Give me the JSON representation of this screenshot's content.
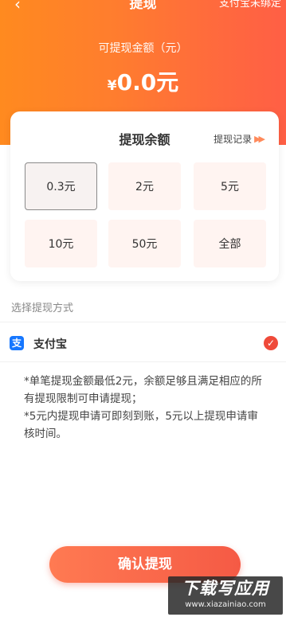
{
  "nav": {
    "back_icon": "chevron-left-icon",
    "title": "提现",
    "right_text": "支付宝未绑定"
  },
  "balance": {
    "label": "可提现金额（元）",
    "currency": "¥",
    "amount": "0.0元"
  },
  "card": {
    "title": "提现余额",
    "record_link": "提现记录",
    "record_arrow_icon": "double-chevron-right-icon",
    "options": [
      "0.3元",
      "2元",
      "5元",
      "10元",
      "50元",
      "全部"
    ],
    "selected_option": "0.3元"
  },
  "method": {
    "label": "选择提现方式",
    "name": "支付宝",
    "icon": "alipay-icon",
    "check_icon": "check-circle-icon",
    "check_color": "#ef4a3a"
  },
  "notes": [
    "*单笔提现金额最低2元，余额足够且满足相应的所有提现限制可申请提现；",
    "*5元内提现申请可即刻到账，5元以上提现申请审核时间。"
  ],
  "confirm_label": "确认提现",
  "watermark": {
    "main": "下载写应用",
    "sub": "www.xiazainiao.com"
  },
  "colors": {
    "header_start": "#ff8a1f",
    "header_end": "#ff5f45",
    "option_bg": "#fff4f1",
    "button_start": "#ff7a52",
    "button_end": "#f55a45"
  }
}
